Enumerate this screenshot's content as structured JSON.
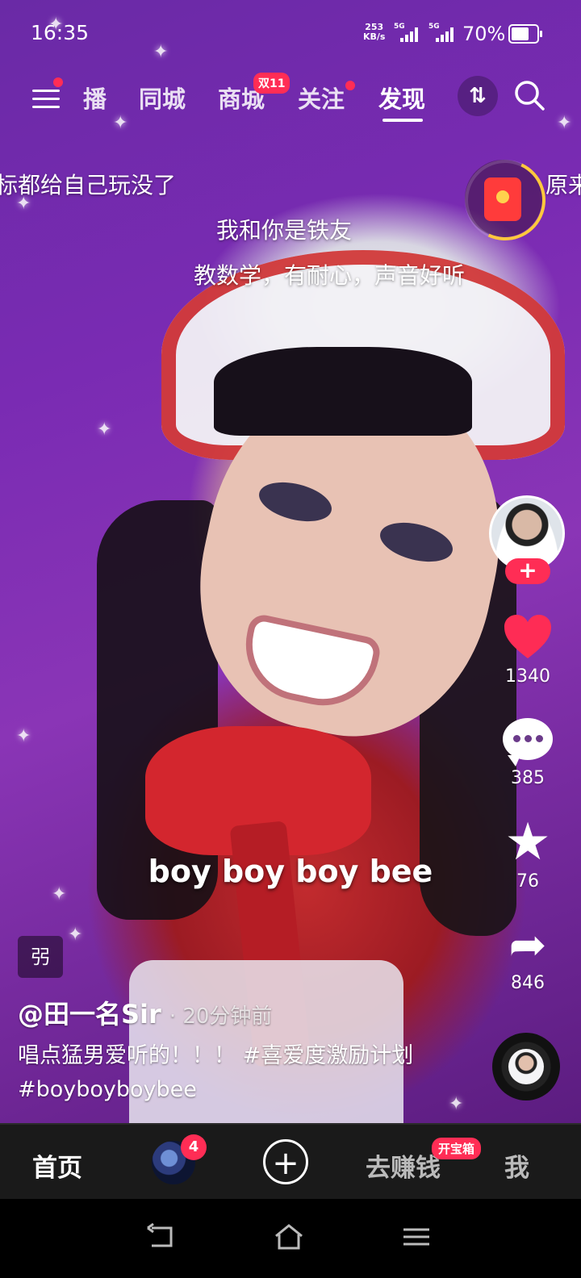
{
  "status_bar": {
    "time": "16:35",
    "net_speed_value": "253",
    "net_speed_unit": "KB/s",
    "sim1": "5G",
    "sim2": "5G",
    "battery_percent": "70%",
    "battery_level": 0.7
  },
  "top_nav": {
    "tabs": [
      {
        "label": "播"
      },
      {
        "label": "同城"
      },
      {
        "label": "商城"
      },
      {
        "label": "关注"
      },
      {
        "label": "发现"
      }
    ],
    "mall_badge": "双11",
    "active_tab": "发现",
    "icons": {
      "menu": "menu-icon",
      "switch": "switch-icon",
      "search": "search-icon"
    }
  },
  "danmu": [
    "标都给自己玩没了",
    "原来",
    "我和你是铁友",
    "教数学，有耐心，声音好听"
  ],
  "video": {
    "caption": "boy boy boy bee",
    "tag_glyph": "弜",
    "author": "@田一名Sir",
    "posted": "· 20分钟前",
    "description": "唱点猛男爱听的！！！ #喜爱度激励计划 #boyboyboybee"
  },
  "actions": {
    "follow_label": "+",
    "likes": "1340",
    "comments": "385",
    "favorites": "76",
    "shares": "846"
  },
  "bottom_nav": {
    "home": "首页",
    "friends_count": "4",
    "add_label": "+",
    "earn": "去赚钱",
    "earn_badge": "开宝箱",
    "me": "我"
  },
  "colors": {
    "accent": "#ff2d55",
    "background_purple": "#7a2bb3",
    "gold": "#ffc83d"
  }
}
